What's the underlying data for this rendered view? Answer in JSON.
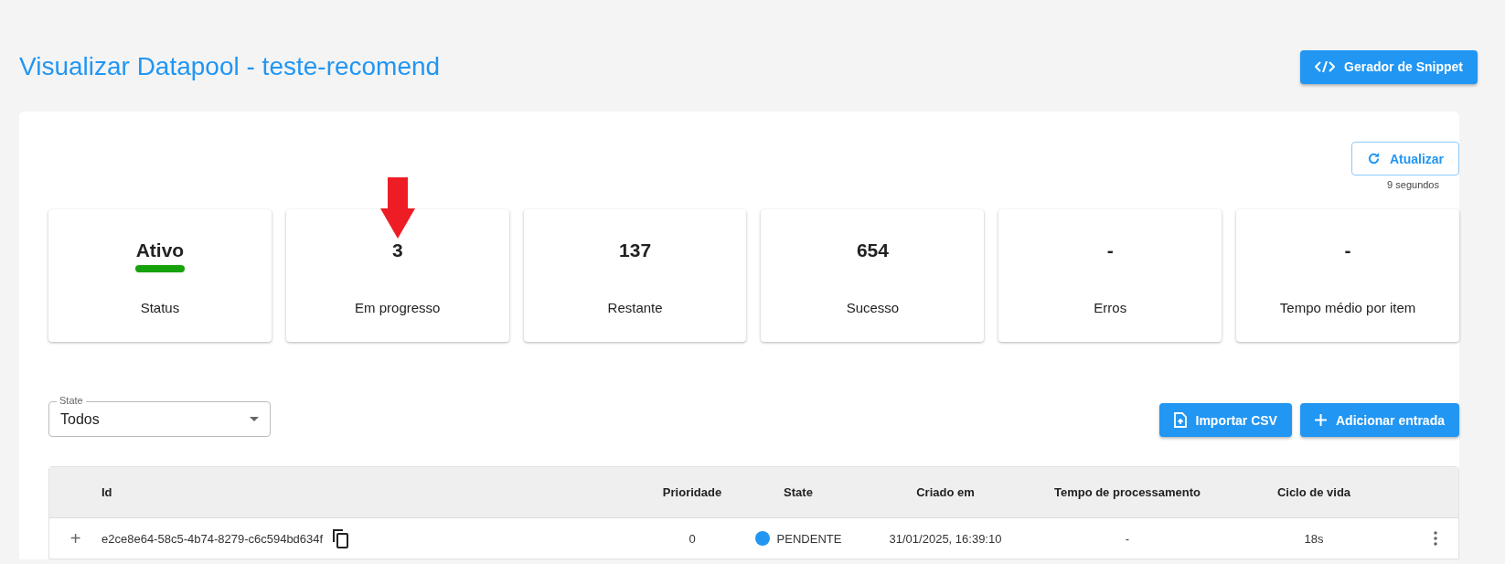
{
  "page_title": "Visualizar Datapool - teste-recomend",
  "snippet_button": {
    "label": "Gerador de Snippet"
  },
  "refresh": {
    "label": "Atualizar",
    "interval": "9 segundos"
  },
  "stats": [
    {
      "kind": "status",
      "value": "Ativo",
      "label": "Status",
      "color": "#17a10a"
    },
    {
      "kind": "number",
      "value": "3",
      "label": "Em progresso"
    },
    {
      "kind": "number",
      "value": "137",
      "label": "Restante"
    },
    {
      "kind": "number",
      "value": "654",
      "label": "Sucesso"
    },
    {
      "kind": "number",
      "value": "-",
      "label": "Erros"
    },
    {
      "kind": "number",
      "value": "-",
      "label": "Tempo médio por item"
    }
  ],
  "state_filter": {
    "label": "State",
    "value": "Todos"
  },
  "actions": [
    {
      "kind": "import",
      "label": "Importar CSV"
    },
    {
      "kind": "add",
      "label": "Adicionar entrada"
    }
  ],
  "table": {
    "columns": [
      "Id",
      "Prioridade",
      "State",
      "Criado em",
      "Tempo de processamento",
      "Ciclo de vida"
    ],
    "rows": [
      {
        "expand": "+",
        "id": "e2ce8e64-58c5-4b74-8279-c6c594bd634f",
        "priority": "0",
        "state": "PENDENTE",
        "color": "#2196f3",
        "created": "31/01/2025, 16:39:10",
        "processing_time": "-",
        "lifecycle": "18s"
      }
    ]
  }
}
